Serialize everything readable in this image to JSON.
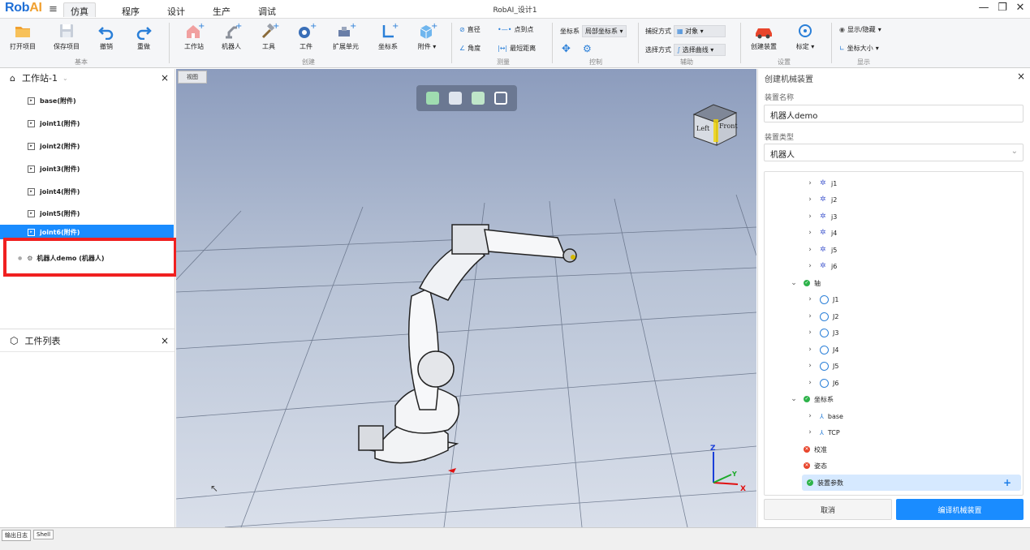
{
  "app": {
    "logo_a": "Rob",
    "logo_b": "AI",
    "window_title": "RobAI_设计1"
  },
  "menu": {
    "tabs": [
      "仿真",
      "程序",
      "设计",
      "生产",
      "调试"
    ]
  },
  "window_controls": {
    "minimize": "—",
    "restore": "❐",
    "close": "✕"
  },
  "ribbon": {
    "groups": {
      "basic": {
        "label": "基本",
        "buttons": [
          "打开项目",
          "保存项目",
          "撤销",
          "重做"
        ]
      },
      "create": {
        "label": "创建",
        "buttons": [
          "工作站",
          "机器人",
          "工具",
          "工件",
          "扩展单元",
          "坐标系",
          "附件"
        ]
      },
      "measure": {
        "label": "测量",
        "items": [
          "直径",
          "点到点",
          "角度",
          "最短距离"
        ]
      },
      "control": {
        "label": "控制",
        "coord_label": "坐标系",
        "coord_value": "局部坐标系"
      },
      "assist": {
        "label": "辅助",
        "capture_label": "捕捉方式",
        "capture_value": "对象",
        "select_label": "选择方式",
        "select_value": "选择曲线"
      },
      "settings": {
        "label": "设置",
        "buttons": [
          "创建装置",
          "标定"
        ]
      },
      "display": {
        "label": "显示",
        "items": [
          "显示/隐藏",
          "坐标大小"
        ]
      }
    }
  },
  "left_panel": {
    "station_title": "工作站-1",
    "tree": [
      "base(附件)",
      "joint1(附件)",
      "joint2(附件)",
      "joint3(附件)",
      "joint4(附件)",
      "joint5(附件)",
      "joint6(附件)"
    ],
    "robot_item": "机器人demo (机器人)",
    "workpiece_title": "工件列表",
    "close": "×"
  },
  "viewport": {
    "tab": "视图",
    "navcube": {
      "left": "Left",
      "front": "Front"
    },
    "axes": {
      "x": "X",
      "y": "Y",
      "z": "Z"
    }
  },
  "right_panel": {
    "title": "创建机械装置",
    "close": "×",
    "name_label": "装置名称",
    "name_value": "机器人demo",
    "type_label": "装置类型",
    "type_value": "机器人",
    "tree": {
      "joints": [
        "j1",
        "j2",
        "j3",
        "j4",
        "j5",
        "j6"
      ],
      "axis_group": "轴",
      "axes": [
        "J1",
        "J2",
        "J3",
        "J4",
        "J5",
        "J6"
      ],
      "frame_group": "坐标系",
      "frames": [
        "base",
        "TCP"
      ],
      "calibration": "校准",
      "posture": "姿态",
      "params": "装置参数"
    },
    "cancel": "取消",
    "compile": "编译机械装置"
  },
  "statusbar": {
    "tabs": [
      "输出日志",
      "Shell"
    ]
  },
  "colors": {
    "accent": "#1a8cff",
    "highlight_red": "#f02020",
    "ok_green": "#2db34a",
    "error_red": "#e8452c"
  }
}
